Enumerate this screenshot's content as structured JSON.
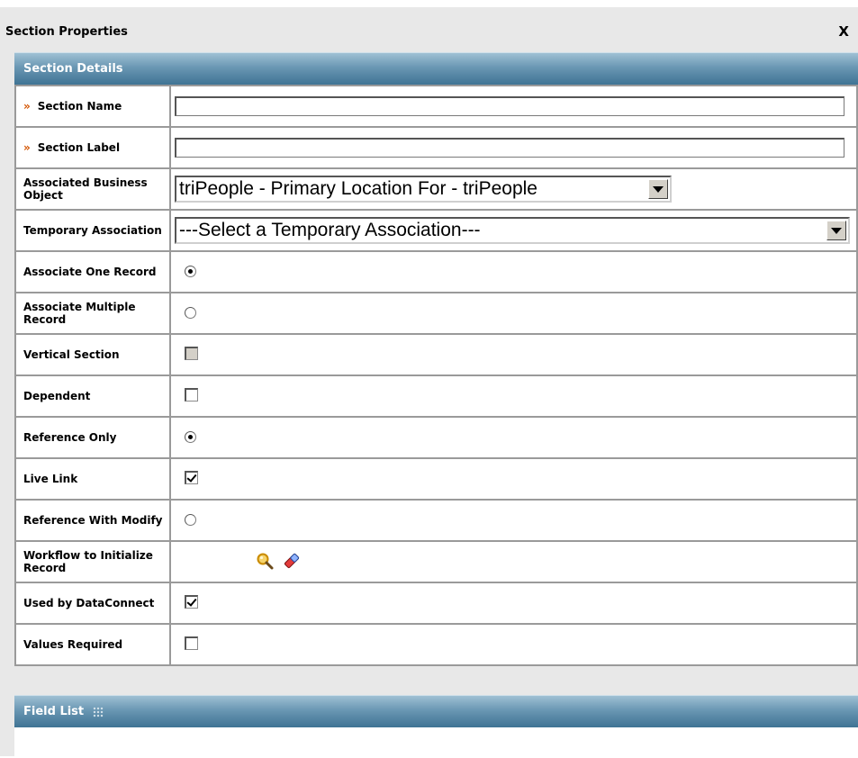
{
  "dialog": {
    "title": "Section Properties",
    "close_label": "X"
  },
  "section_details": {
    "header": "Section Details",
    "rows": {
      "section_name": {
        "label": "Section Name",
        "value": "",
        "required": true
      },
      "section_label": {
        "label": "Section Label",
        "value": "",
        "required": true
      },
      "associated_bo": {
        "label": "Associated Business Object",
        "selected": "triPeople - Primary Location For - triPeople"
      },
      "temp_assoc": {
        "label": "Temporary Association",
        "selected": "---Select a Temporary Association---"
      },
      "assoc_one": {
        "label": "Associate One Record",
        "checked": true
      },
      "assoc_multi": {
        "label": "Associate Multiple Record",
        "checked": false
      },
      "vertical": {
        "label": "Vertical Section",
        "checked": false,
        "disabled": true
      },
      "dependent": {
        "label": "Dependent",
        "checked": false
      },
      "ref_only": {
        "label": "Reference Only",
        "checked": true
      },
      "live_link": {
        "label": "Live Link",
        "checked": true
      },
      "ref_modify": {
        "label": "Reference With Modify",
        "checked": false
      },
      "workflow": {
        "label": "Workflow to Initialize Record",
        "icons": [
          "magnifier-icon",
          "eraser-icon"
        ]
      },
      "dataconnect": {
        "label": "Used by DataConnect",
        "checked": true
      },
      "values_required": {
        "label": "Values Required",
        "checked": false
      }
    }
  },
  "field_list": {
    "header": "Field List",
    "icon": "grid-dots-icon"
  },
  "colors": {
    "band_top": "#9fc0d4",
    "band_bottom": "#3f7394",
    "required_marker": "#d35400",
    "dialog_bg": "#e8e8e8"
  }
}
